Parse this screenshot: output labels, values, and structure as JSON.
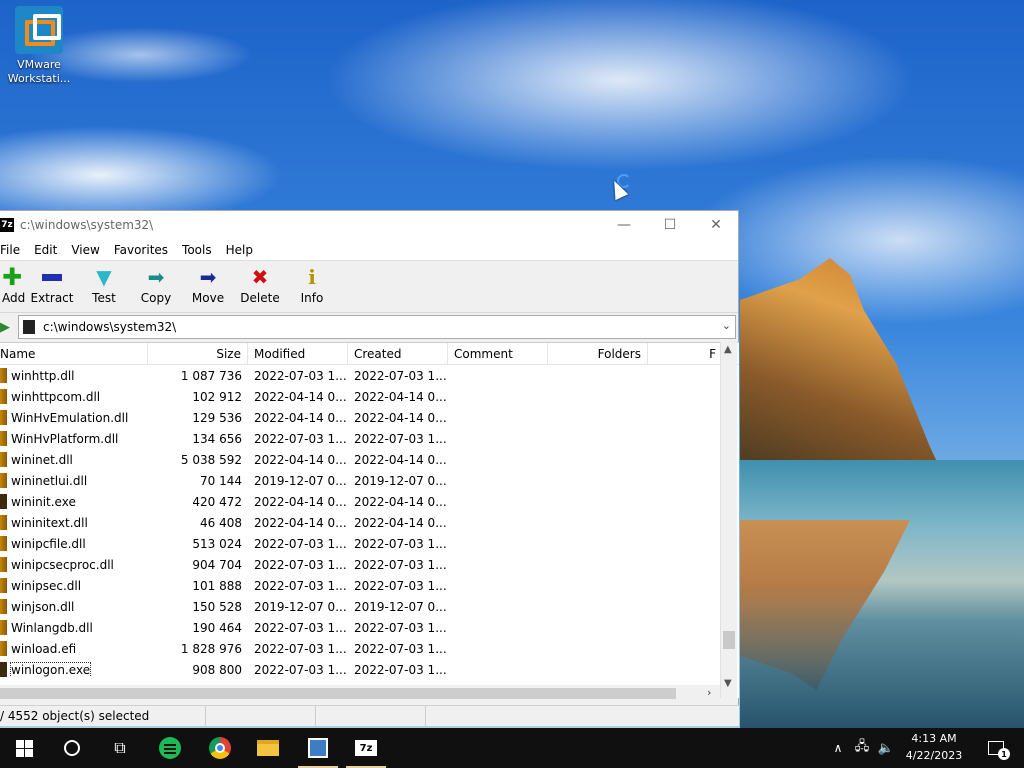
{
  "desktop": {
    "icon_label_line1": "VMware",
    "icon_label_line2": "Workstati..."
  },
  "window": {
    "app_icon_text": "7z",
    "title": "c:\\windows\\system32\\",
    "minimize_glyph": "—",
    "maximize_glyph": "☐",
    "close_glyph": "✕"
  },
  "menu": [
    "File",
    "Edit",
    "View",
    "Favorites",
    "Tools",
    "Help"
  ],
  "toolbar": {
    "add": "Add",
    "extract": "Extract",
    "test": "Test",
    "copy": "Copy",
    "move": "Move",
    "delete": "Delete",
    "info": "Info"
  },
  "address": {
    "path": "c:\\windows\\system32\\"
  },
  "columns": {
    "name": "Name",
    "size": "Size",
    "modified": "Modified",
    "created": "Created",
    "comment": "Comment",
    "folders": "Folders",
    "f": "F"
  },
  "files": [
    {
      "name": "winhttp.dll",
      "size": "1 087 736",
      "modified": "2022-07-03 1...",
      "created": "2022-07-03 1...",
      "type": "dll"
    },
    {
      "name": "winhttpcom.dll",
      "size": "102 912",
      "modified": "2022-04-14 0...",
      "created": "2022-04-14 0...",
      "type": "dll"
    },
    {
      "name": "WinHvEmulation.dll",
      "size": "129 536",
      "modified": "2022-04-14 0...",
      "created": "2022-04-14 0...",
      "type": "dll"
    },
    {
      "name": "WinHvPlatform.dll",
      "size": "134 656",
      "modified": "2022-07-03 1...",
      "created": "2022-07-03 1...",
      "type": "dll"
    },
    {
      "name": "wininet.dll",
      "size": "5 038 592",
      "modified": "2022-04-14 0...",
      "created": "2022-04-14 0...",
      "type": "dll"
    },
    {
      "name": "wininetlui.dll",
      "size": "70 144",
      "modified": "2019-12-07 0...",
      "created": "2019-12-07 0...",
      "type": "dll"
    },
    {
      "name": "wininit.exe",
      "size": "420 472",
      "modified": "2022-04-14 0...",
      "created": "2022-04-14 0...",
      "type": "exe"
    },
    {
      "name": "wininitext.dll",
      "size": "46 408",
      "modified": "2022-04-14 0...",
      "created": "2022-04-14 0...",
      "type": "dll"
    },
    {
      "name": "winipcfile.dll",
      "size": "513 024",
      "modified": "2022-07-03 1...",
      "created": "2022-07-03 1...",
      "type": "dll"
    },
    {
      "name": "winipcsecproc.dll",
      "size": "904 704",
      "modified": "2022-07-03 1...",
      "created": "2022-07-03 1...",
      "type": "dll"
    },
    {
      "name": "winipsec.dll",
      "size": "101 888",
      "modified": "2022-07-03 1...",
      "created": "2022-07-03 1...",
      "type": "dll"
    },
    {
      "name": "winjson.dll",
      "size": "150 528",
      "modified": "2019-12-07 0...",
      "created": "2019-12-07 0...",
      "type": "dll"
    },
    {
      "name": "Winlangdb.dll",
      "size": "190 464",
      "modified": "2022-07-03 1...",
      "created": "2022-07-03 1...",
      "type": "dll"
    },
    {
      "name": "winload.efi",
      "size": "1 828 976",
      "modified": "2022-07-03 1...",
      "created": "2022-07-03 1...",
      "type": "dll"
    },
    {
      "name": "winlogon.exe",
      "size": "908 800",
      "modified": "2022-07-03 1...",
      "created": "2022-07-03 1...",
      "type": "exe",
      "focused": true
    }
  ],
  "status": {
    "selection": "/ 4552 object(s) selected"
  },
  "taskbar": {
    "app_7z_label": "7z",
    "time": "4:13 AM",
    "date": "4/22/2023",
    "notification_count": "1"
  }
}
